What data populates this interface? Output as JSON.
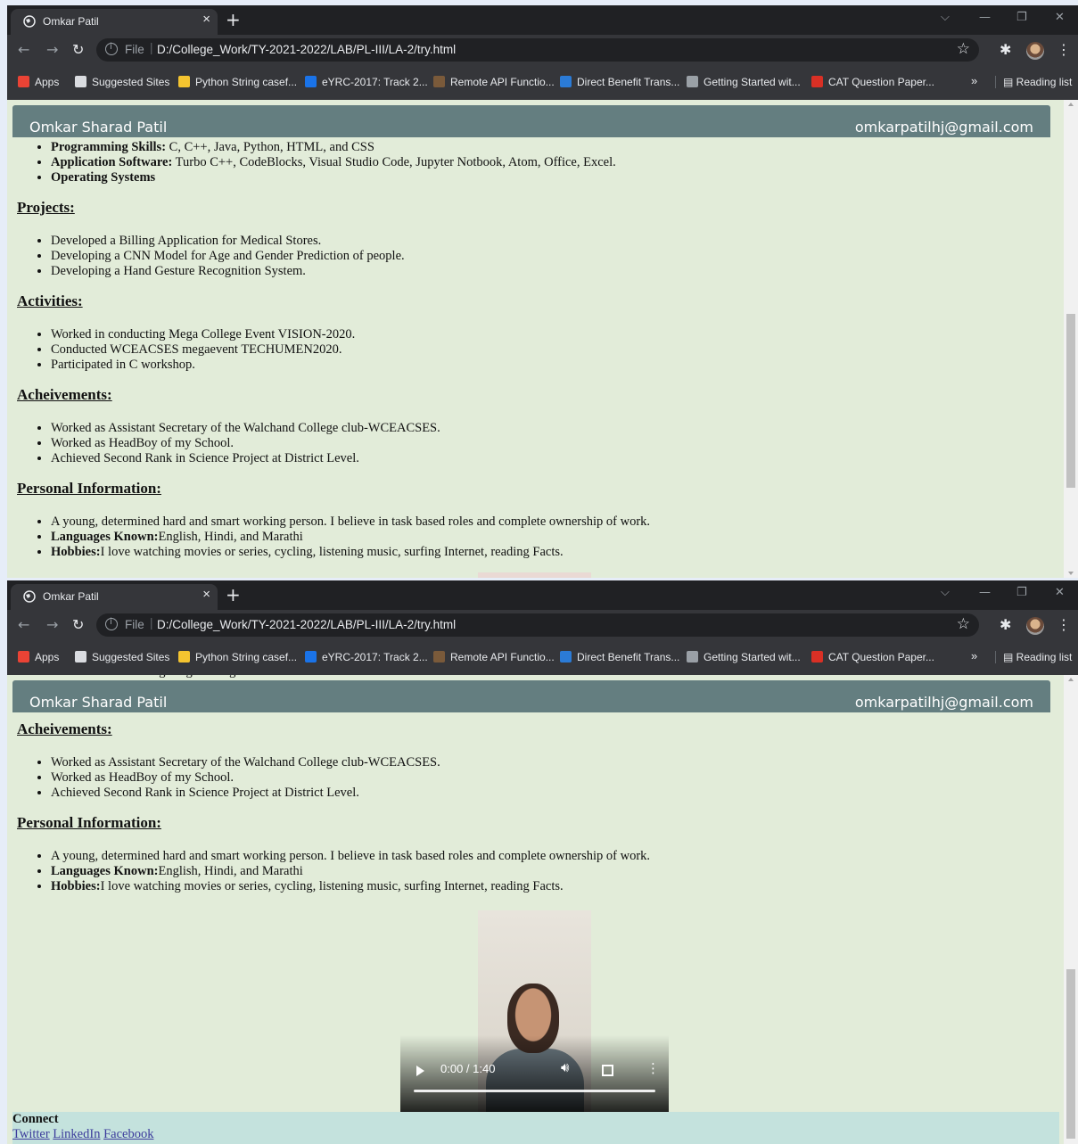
{
  "browser": {
    "tab_title": "Omkar Patil",
    "tab_close": "×",
    "new_tab": "+",
    "url_scheme": "File",
    "url": "D:/College_Work/TY-2021-2022/LAB/PL-III/LA-2/try.html",
    "bookmarks": [
      {
        "label": "Apps",
        "icon": "apps-grid-icon",
        "color": "#ea4335"
      },
      {
        "label": "Suggested Sites",
        "icon": "globe-icon",
        "color": "#dadce0"
      },
      {
        "label": "Python String casef...",
        "icon": "python-icon",
        "color": "#f4c430"
      },
      {
        "label": "eYRC-2017: Track 2...",
        "icon": "p-badge-icon",
        "color": "#1a73e8"
      },
      {
        "label": "Remote API Functio...",
        "icon": "pin-icon",
        "color": "#7a5a3a"
      },
      {
        "label": "Direct Benefit Trans...",
        "icon": "dbt-icon",
        "color": "#2b7bd6"
      },
      {
        "label": "Getting Started wit...",
        "icon": "book-icon",
        "color": "#9aa0a6"
      },
      {
        "label": "CAT Question Paper...",
        "icon": "cat-icon",
        "color": "#d93025"
      }
    ],
    "more": "»",
    "reading_list": "Reading list"
  },
  "page": {
    "name": "Omkar Sharad Patil",
    "email": "omkarpatilhj@gmail.com",
    "skills": [
      {
        "bold": "Programming Skills:",
        "text": " C, C++, Java, Python, HTML, and CSS"
      },
      {
        "bold": "Application Software:",
        "text": " Turbo C++, CodeBlocks, Visual Studio Code, Jupyter Notbook, Atom, Office, Excel."
      },
      {
        "bold": "Operating Systems",
        "text": ""
      }
    ],
    "projects_heading": "Projects:",
    "projects": [
      "Developed a Billing Application for Medical Stores.",
      "Developing a CNN Model for Age and Gender Prediction of people.",
      "Developing a Hand Gesture Recognition System."
    ],
    "activities_heading": "Activities:",
    "activities": [
      "Worked in conducting Mega College Event VISION-2020.",
      "Conducted WCEACSES megaevent TECHUMEN2020.",
      "Participated in C workshop."
    ],
    "achievements_heading": "Acheivements:",
    "achievements": [
      "Worked as Assistant Secretary of the Walchand College club-WCEACSES.",
      "Worked as HeadBoy of my School.",
      "Achieved Second Rank in Science Project at District Level."
    ],
    "personal_heading": "Personal Information:",
    "personal": [
      {
        "bold": "",
        "text": "A young, determined hard and smart working person. I believe in task based roles and complete ownership of work."
      },
      {
        "bold": "Languages Known:",
        "text": "English, Hindi, and Marathi"
      },
      {
        "bold": "Hobbies:",
        "text": "I love watching movies or series, cycling, listening music, surfing Internet, reading Facts."
      }
    ],
    "video": {
      "time": "0:00 / 1:40",
      "progress": 0
    },
    "footer": {
      "connect": "Connect",
      "links": [
        "Twitter",
        "LinkedIn",
        "Facebook"
      ]
    }
  }
}
